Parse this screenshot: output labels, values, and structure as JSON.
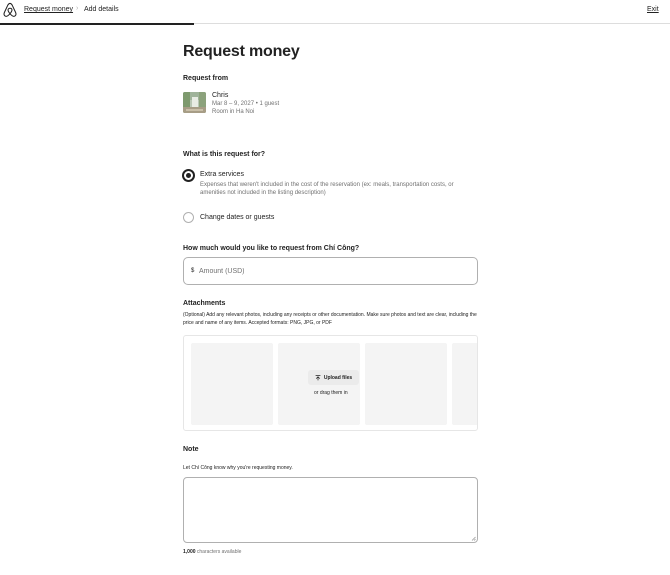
{
  "header": {
    "breadcrumb_1": "Request money",
    "breadcrumb_separator": "›",
    "breadcrumb_2": "Add details",
    "exit_label": "Exit",
    "progress_fraction": 0.29
  },
  "page": {
    "title": "Request money"
  },
  "request_from": {
    "heading": "Request from",
    "guest_name": "Chris",
    "dates": "Mar 8 – 9, 2027 • 1 guest",
    "listing": "Room in Ha Noi"
  },
  "reason": {
    "heading": "What is this request for?",
    "options": [
      {
        "label": "Extra services",
        "description": "Expenses that weren't included in the cost of the reservation (ex: meals, transportation costs, or amenities not included in the listing description)",
        "selected": true
      },
      {
        "label": "Change dates or guests",
        "selected": false
      }
    ]
  },
  "amount": {
    "heading": "How much would you like to request from Chí Công?",
    "currency_symbol": "$",
    "placeholder": "Amount (USD)",
    "value": ""
  },
  "attachments": {
    "heading": "Attachments",
    "description": "(Optional) Add any relevant photos, including any receipts or other documentation. Make sure photos and text are clear, including the price and name of any items. Accepted formats: PNG, JPG, or PDF",
    "upload_label": "Upload files",
    "drag_label": "or drag them in"
  },
  "note": {
    "heading": "Note",
    "label": "Let Chí Công know why you're requesting money.",
    "value": "",
    "chars_count": "1,000",
    "chars_suffix": " characters available"
  },
  "icons": {
    "logo": "airbnb-logo-icon",
    "upload": "upload-arrow-icon",
    "resize": "resize-grip-icon"
  },
  "colors": {
    "text": "#222222",
    "muted": "#717171",
    "border": "#b0b0b0",
    "logo": "#e6e6e6"
  }
}
